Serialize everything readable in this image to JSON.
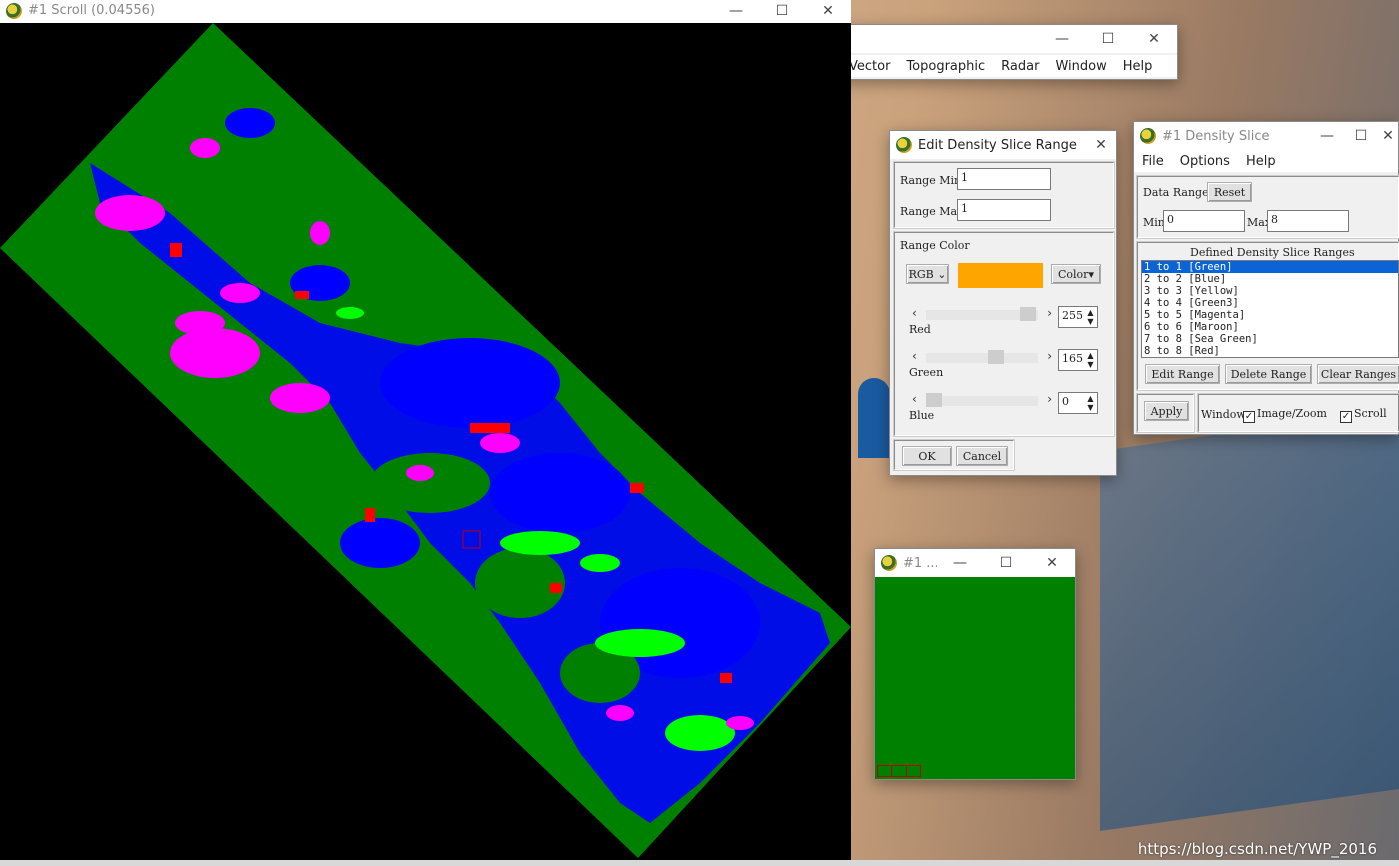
{
  "colors": {
    "map_green": "#008000",
    "water_blue": "#0000ff",
    "magenta": "#ff00ff",
    "bright_green": "#00ff00",
    "red": "#ff0000",
    "yellow": "#ffff00",
    "range_color": "#ffa500",
    "selected_row": "#0a64d6"
  },
  "scroll_window": {
    "title": "#1 Scroll (0.04556)",
    "icon": "envi-globe-icon"
  },
  "main_menu": {
    "items": [
      "Vector",
      "Topographic",
      "Radar",
      "Window",
      "Help"
    ]
  },
  "edit_dialog": {
    "title": "Edit Density Slice Range",
    "range_min_label": "Range Min",
    "range_min_value": "1",
    "range_max_label": "Range Max",
    "range_max_value": "1",
    "range_color_label": "Range Color",
    "model_select": "RGB",
    "color_button": "Color",
    "sliders": [
      {
        "label": "Red",
        "value": "255"
      },
      {
        "label": "Green",
        "value": "165"
      },
      {
        "label": "Blue",
        "value": "0"
      }
    ],
    "ok_label": "OK",
    "cancel_label": "Cancel"
  },
  "density_slice": {
    "title": "#1 Density Slice",
    "menu": [
      "File",
      "Options",
      "Help"
    ],
    "data_range_label": "Data Range",
    "reset_label": "Reset",
    "min_label": "Min",
    "min_value": "0",
    "max_label": "Max",
    "max_value": "8",
    "ranges_header": "Defined Density Slice Ranges",
    "ranges": [
      "1 to 1 [Green]",
      "2 to 2 [Blue]",
      "3 to 3 [Yellow]",
      "4 to 4 [Green3]",
      "5 to 5 [Magenta]",
      "6 to 6 [Maroon]",
      "7 to 8 [Sea Green]",
      "8 to 8 [Red]"
    ],
    "selected_index": 0,
    "edit_range_label": "Edit Range",
    "delete_range_label": "Delete Range",
    "clear_ranges_label": "Clear Ranges",
    "apply_label": "Apply",
    "window_label": "Window",
    "image_zoom_label": "Image/Zoom",
    "image_zoom_checked": true,
    "scroll_label": "Scroll",
    "scroll_checked": true
  },
  "zoom_window": {
    "title": "#1 ..."
  },
  "watermark": "https://blog.csdn.net/YWP_2016"
}
